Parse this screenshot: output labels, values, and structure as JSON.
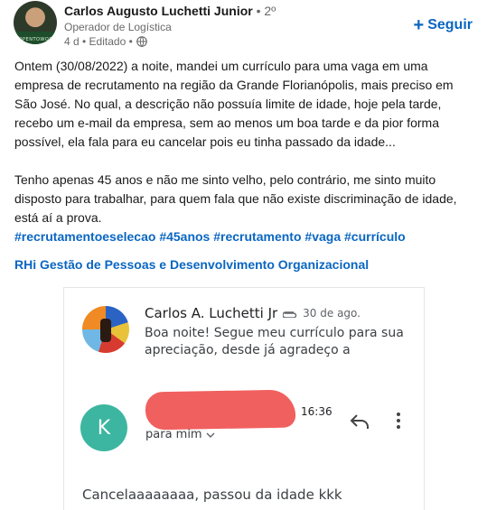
{
  "post": {
    "author": {
      "name": "Carlos Augusto Luchetti Junior",
      "degree": "• 2º",
      "headline": "Operador de Logística",
      "meta": "4 d • Editado •",
      "avatar_ring_text": "#OPENTOWORK"
    },
    "follow_label": "Seguir",
    "paragraphs": [
      "Ontem (30/08/2022) a noite, mandei um currículo para uma vaga em uma empresa de recrutamento na região da Grande Florianópolis, mais preciso em São José. No qual, a descrição não possuía limite de idade, hoje pela tarde, recebo um e-mail da empresa, sem ao menos um boa tarde e da pior forma possível, ela fala para eu cancelar pois eu tinha passado da idade...",
      "Tenho apenas 45 anos e não me sinto velho, pelo contrário, me sinto muito disposto para trabalhar, para quem fala que não existe discriminação de idade, está aí a prova."
    ],
    "hashtags": [
      "#recrutamentoeselecao",
      "#45anos",
      "#recrutamento",
      "#vaga",
      "#currículo"
    ],
    "company_mention": "RHi Gestão de Pessoas e Desenvolvimento Organizacional"
  },
  "email_screenshot": {
    "sender": "Carlos A. Luchetti Jr",
    "date": "30 de ago.",
    "snippet": "Boa noite! Segue meu currículo para sua apreciação, desde já agradeço a",
    "reply_avatar_letter": "K",
    "reply_time": "16:36",
    "reply_to": "para mim",
    "reply_body": "Cancelaaaaaaaa, passou da idade kkk"
  },
  "colors": {
    "link_blue": "#0a66c2",
    "redaction": "#f0605f",
    "reply_avatar": "#3cb6a0"
  },
  "icons": [
    "globe-icon",
    "plus-icon",
    "paperclip-icon",
    "chevron-down-icon",
    "reply-icon",
    "more-vert-icon"
  ]
}
